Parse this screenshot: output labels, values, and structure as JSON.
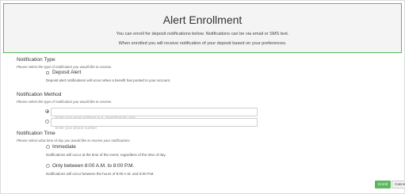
{
  "header": {
    "title": "Alert Enrollment",
    "subtitle_line1": "You can enroll for deposit notifications below. Notifications can be via email or SMS text.",
    "subtitle_line2": "When enrolled you will receive notification of your deposit based on your preferences."
  },
  "type_section": {
    "title": "Notification Type",
    "hint": "Please select the type of notification you would like to receive.",
    "option_label": "Deposit Alert",
    "option_desc": "Deposit alert notifications will occur when a benefit has posted to your account."
  },
  "method_section": {
    "title": "Notification Method",
    "hint": "Please select the type of notification you would like to receive.",
    "email_placeholder": "Enter your email address (e.g. client@gmail.com)",
    "phone_placeholder": "Enter your phone number",
    "email_selected": true
  },
  "time_section": {
    "title": "Notification Time",
    "hint": "Please select what time of day you would like to receive your notifications.",
    "immediate_label": "Immediate",
    "immediate_desc": "Notifications will occur at the time of the event, regardless of the time of day.",
    "window_label": "Only between 8:00 A.M. to 8:00 P.M.",
    "window_desc": "Notifications will occur between the hours of 8:00 A.M. and 8:00 P.M."
  },
  "actions": {
    "enroll_label": "Enroll",
    "cancel_label": "Cancel"
  },
  "colors": {
    "accent": "#5cb85c",
    "header_bg": "#f4f4f4"
  }
}
